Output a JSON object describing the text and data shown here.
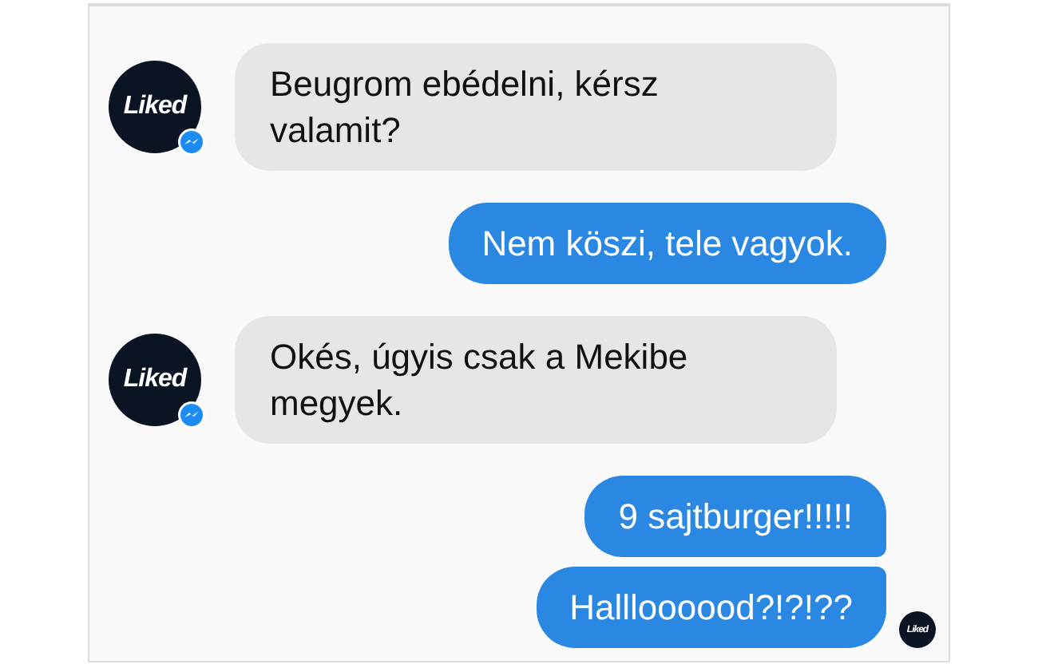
{
  "messages": [
    {
      "kind": "incoming",
      "text": "Beugrom ebédelni, kérsz valamit?",
      "avatar": "Liked"
    },
    {
      "kind": "outgoing",
      "text": "Nem köszi, tele vagyok."
    },
    {
      "kind": "incoming",
      "text": "Okés, úgyis csak a Mekibe megyek.",
      "avatar": "Liked"
    },
    {
      "kind": "outgoing",
      "text": "9 sajtburger!!!!!"
    },
    {
      "kind": "outgoing",
      "text": "Hallloooood?!?!??"
    }
  ],
  "read_receipt": {
    "avatar": "Liked"
  }
}
